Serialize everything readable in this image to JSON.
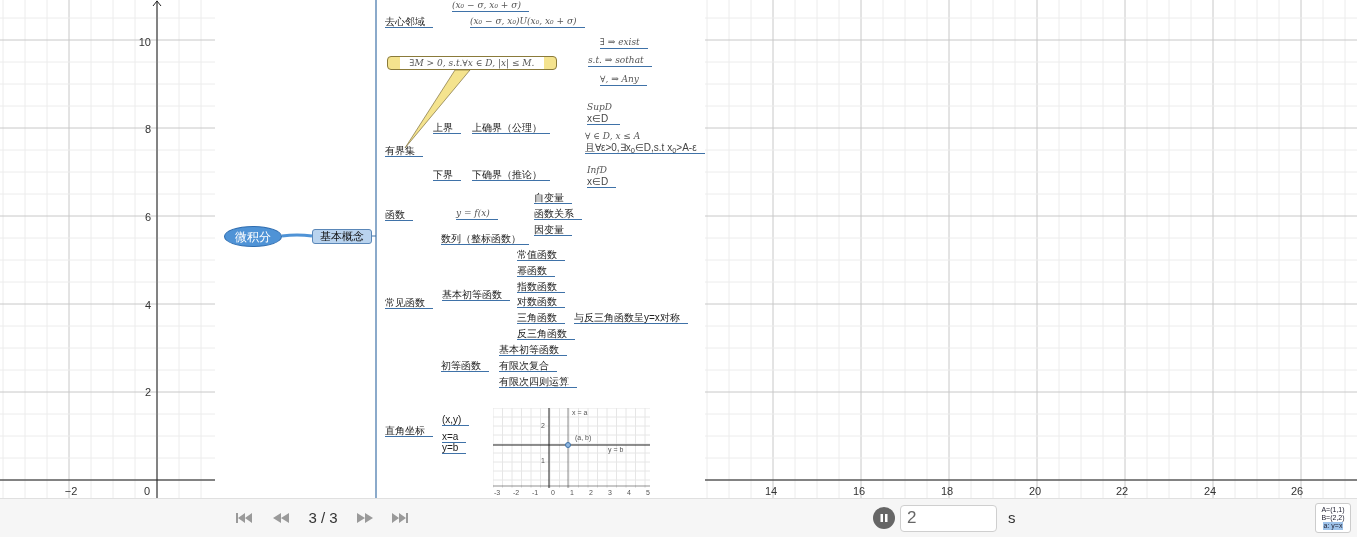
{
  "graphics_view": {
    "x_ticks": [
      "−2",
      "14",
      "16",
      "18",
      "20",
      "22",
      "24",
      "26"
    ],
    "origin_label": "0",
    "y_ticks": [
      "10",
      "8",
      "6",
      "4",
      "2"
    ]
  },
  "mind_map": {
    "root": "微积分",
    "central": "基本概念",
    "branches": [
      {
        "text": "(x₀ − σ, x₀ + σ)",
        "kind": "formula"
      },
      {
        "text": "去心邻域",
        "kind": "label",
        "children": [
          {
            "text": "(x₀ − σ, x₀)U(x₀, x₀ + σ)",
            "kind": "formula"
          }
        ]
      },
      {
        "text": "有界集",
        "kind": "label",
        "callout": {
          "text": "∃M > 0, s.t.∀x ∈ D, |x| ≤ M.",
          "children": [
            {
              "text": "∃ ⇒ exist",
              "kind": "formula"
            },
            {
              "text": "s.t. ⇒ sothat",
              "kind": "formula"
            },
            {
              "text": "∀, ⇒ Any",
              "kind": "formula"
            }
          ]
        },
        "children": [
          {
            "text": "上界",
            "kind": "label",
            "children": [
              {
                "text": "上确界（公理）",
                "kind": "label",
                "children": [
                  {
                    "text": "SupD",
                    "kind": "formula",
                    "note": "x∈D"
                  },
                  {
                    "text": "∀ ∈ D, x ≤ A",
                    "kind": "formula",
                    "note": "且∀ε>0,∃x$_{0}$∈D,s.t x$_{0}$>A-ε"
                  }
                ]
              }
            ]
          },
          {
            "text": "下界",
            "kind": "label",
            "children": [
              {
                "text": "下确界（推论）",
                "kind": "label",
                "children": [
                  {
                    "text": "InfD",
                    "kind": "formula",
                    "note": "x∈D"
                  }
                ]
              }
            ]
          }
        ]
      },
      {
        "text": "函数",
        "kind": "label",
        "children": [
          {
            "text": "y = f(x)",
            "kind": "formula",
            "children": [
              {
                "text": "自变量",
                "kind": "label"
              },
              {
                "text": "函数关系",
                "kind": "label"
              },
              {
                "text": "因变量",
                "kind": "label"
              }
            ]
          }
        ]
      },
      {
        "text": "常见函数",
        "kind": "label",
        "children": [
          {
            "text": "数列（整标函数）",
            "kind": "label"
          },
          {
            "text": "基本初等函数",
            "kind": "label",
            "children": [
              {
                "text": "常值函数",
                "kind": "label"
              },
              {
                "text": "幂函数",
                "kind": "label"
              },
              {
                "text": "指数函数",
                "kind": "label"
              },
              {
                "text": "对数函数",
                "kind": "label"
              },
              {
                "text": "三角函数",
                "kind": "label",
                "children": [
                  {
                    "text": "与反三角函数呈y=x对称",
                    "kind": "label"
                  }
                ]
              },
              {
                "text": "反三角函数",
                "kind": "label"
              }
            ]
          },
          {
            "text": "初等函数",
            "kind": "label",
            "children": [
              {
                "text": "基本初等函数",
                "kind": "label"
              },
              {
                "text": "有限次复合",
                "kind": "label"
              },
              {
                "text": "有限次四则运算",
                "kind": "label"
              }
            ]
          }
        ]
      },
      {
        "text": "直角坐标",
        "kind": "label",
        "children": [
          {
            "text": "(x,y)",
            "kind": "label"
          },
          {
            "text": "x=a",
            "kind": "label"
          },
          {
            "text": "y=b",
            "kind": "label"
          }
        ],
        "plot": {
          "x_labels": [
            "-3",
            "-2",
            "-1",
            "0",
            "1",
            "2",
            "3",
            "4",
            "5"
          ],
          "y_labels": [
            "2",
            "1"
          ],
          "line_label": "x = a",
          "point_label": "(a, b)",
          "hline_label": "y = b"
        }
      }
    ]
  },
  "playback": {
    "position": "3 / 3",
    "playing": true,
    "interval": "2",
    "unit": "s"
  },
  "algebra_icon": [
    "A=(1,1)",
    "B=(2,2)",
    "a: y=x"
  ]
}
